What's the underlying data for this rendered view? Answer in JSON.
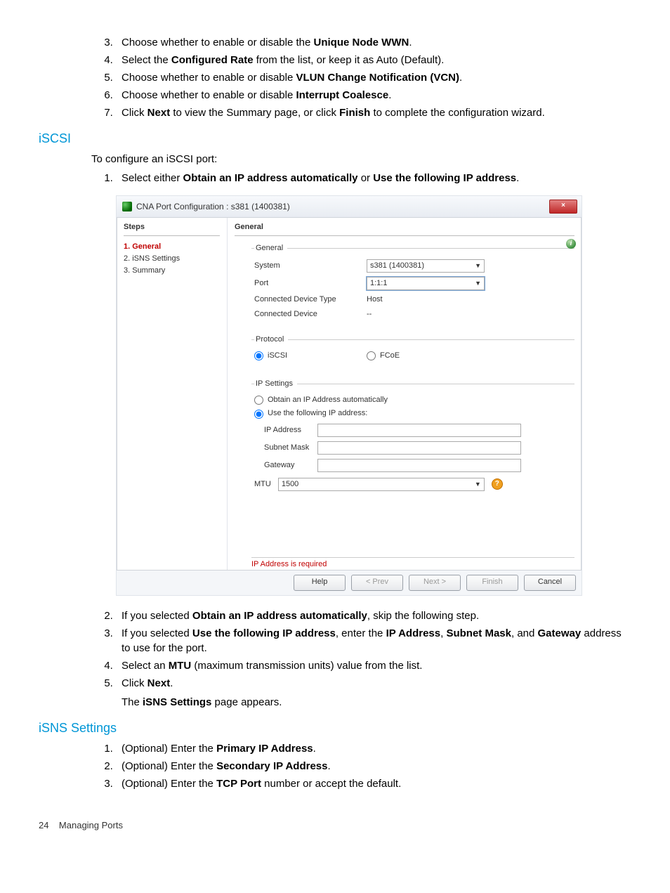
{
  "list1": {
    "start": 3,
    "i3": {
      "pre": "Choose whether to enable or disable the ",
      "b": "Unique Node WWN",
      "post": "."
    },
    "i4": {
      "pre": "Select the ",
      "b": "Configured Rate",
      "post": " from the list, or keep it as Auto (Default)."
    },
    "i5": {
      "pre": "Choose whether to enable or disable ",
      "b": "VLUN Change Notification (VCN)",
      "post": "."
    },
    "i6": {
      "pre": "Choose whether to enable or disable ",
      "b": "Interrupt Coalesce",
      "post": "."
    },
    "i7": {
      "pre": "Click ",
      "b1": "Next",
      "mid": " to view the Summary page, or click ",
      "b2": "Finish",
      "post": " to complete the configuration wizard."
    }
  },
  "heading_iscsi": "iSCSI",
  "intro_iscsi": "To configure an iSCSI port:",
  "list2": {
    "start": 1,
    "i1": {
      "pre": "Select either ",
      "b1": "Obtain an IP address automatically",
      "mid": " or ",
      "b2": "Use the following IP address",
      "post": "."
    }
  },
  "dialog": {
    "title": "CNA Port Configuration : s381 (1400381)",
    "close": "×",
    "steps_header": "Steps",
    "main_header": "General",
    "steps": [
      "1. General",
      "2. iSNS Settings",
      "3. Summary"
    ],
    "general": {
      "legend": "General",
      "system_lbl": "System",
      "system_val": "s381 (1400381)",
      "port_lbl": "Port",
      "port_val": "1:1:1",
      "cdt_lbl": "Connected Device Type",
      "cdt_val": "Host",
      "cd_lbl": "Connected Device",
      "cd_val": "--"
    },
    "protocol": {
      "legend": "Protocol",
      "iscsi": "iSCSI",
      "fcoe": "FCoE"
    },
    "ipsettings": {
      "legend": "IP Settings",
      "auto": "Obtain an IP Address automatically",
      "static": "Use the following IP address:",
      "ip_lbl": "IP Address",
      "sm_lbl": "Subnet Mask",
      "gw_lbl": "Gateway",
      "mtu_lbl": "MTU",
      "mtu_val": "1500"
    },
    "error": "IP Address is required",
    "buttons": {
      "help": "Help",
      "prev": "< Prev",
      "next": "Next >",
      "finish": "Finish",
      "cancel": "Cancel"
    }
  },
  "list3": {
    "start": 2,
    "i2": {
      "pre": "If you selected ",
      "b": "Obtain an IP address automatically",
      "post": ", skip the following step."
    },
    "i3": {
      "pre": "If you selected ",
      "b1": "Use the following IP address",
      "mid1": ", enter the ",
      "b2": "IP Address",
      "mid2": ", ",
      "b3": "Subnet Mask",
      "mid3": ", and ",
      "b4": "Gateway",
      "post": " address to use for the port."
    },
    "i4": {
      "pre": "Select an ",
      "b": "MTU",
      "post": " (maximum transmission units) value from the list."
    },
    "i5": {
      "pre": "Click ",
      "b": "Next",
      "post": "."
    },
    "tail_pre": "The ",
    "tail_b": "iSNS Settings",
    "tail_post": " page appears."
  },
  "heading_isns": "iSNS Settings",
  "list4": {
    "start": 1,
    "i1": {
      "pre": "(Optional) Enter the ",
      "b": "Primary IP Address",
      "post": "."
    },
    "i2": {
      "pre": "(Optional) Enter the ",
      "b": "Secondary IP Address",
      "post": "."
    },
    "i3": {
      "pre": "(Optional) Enter the ",
      "b": "TCP Port",
      "post": " number or accept the default."
    }
  },
  "footer": {
    "page": "24",
    "title": "Managing Ports"
  }
}
